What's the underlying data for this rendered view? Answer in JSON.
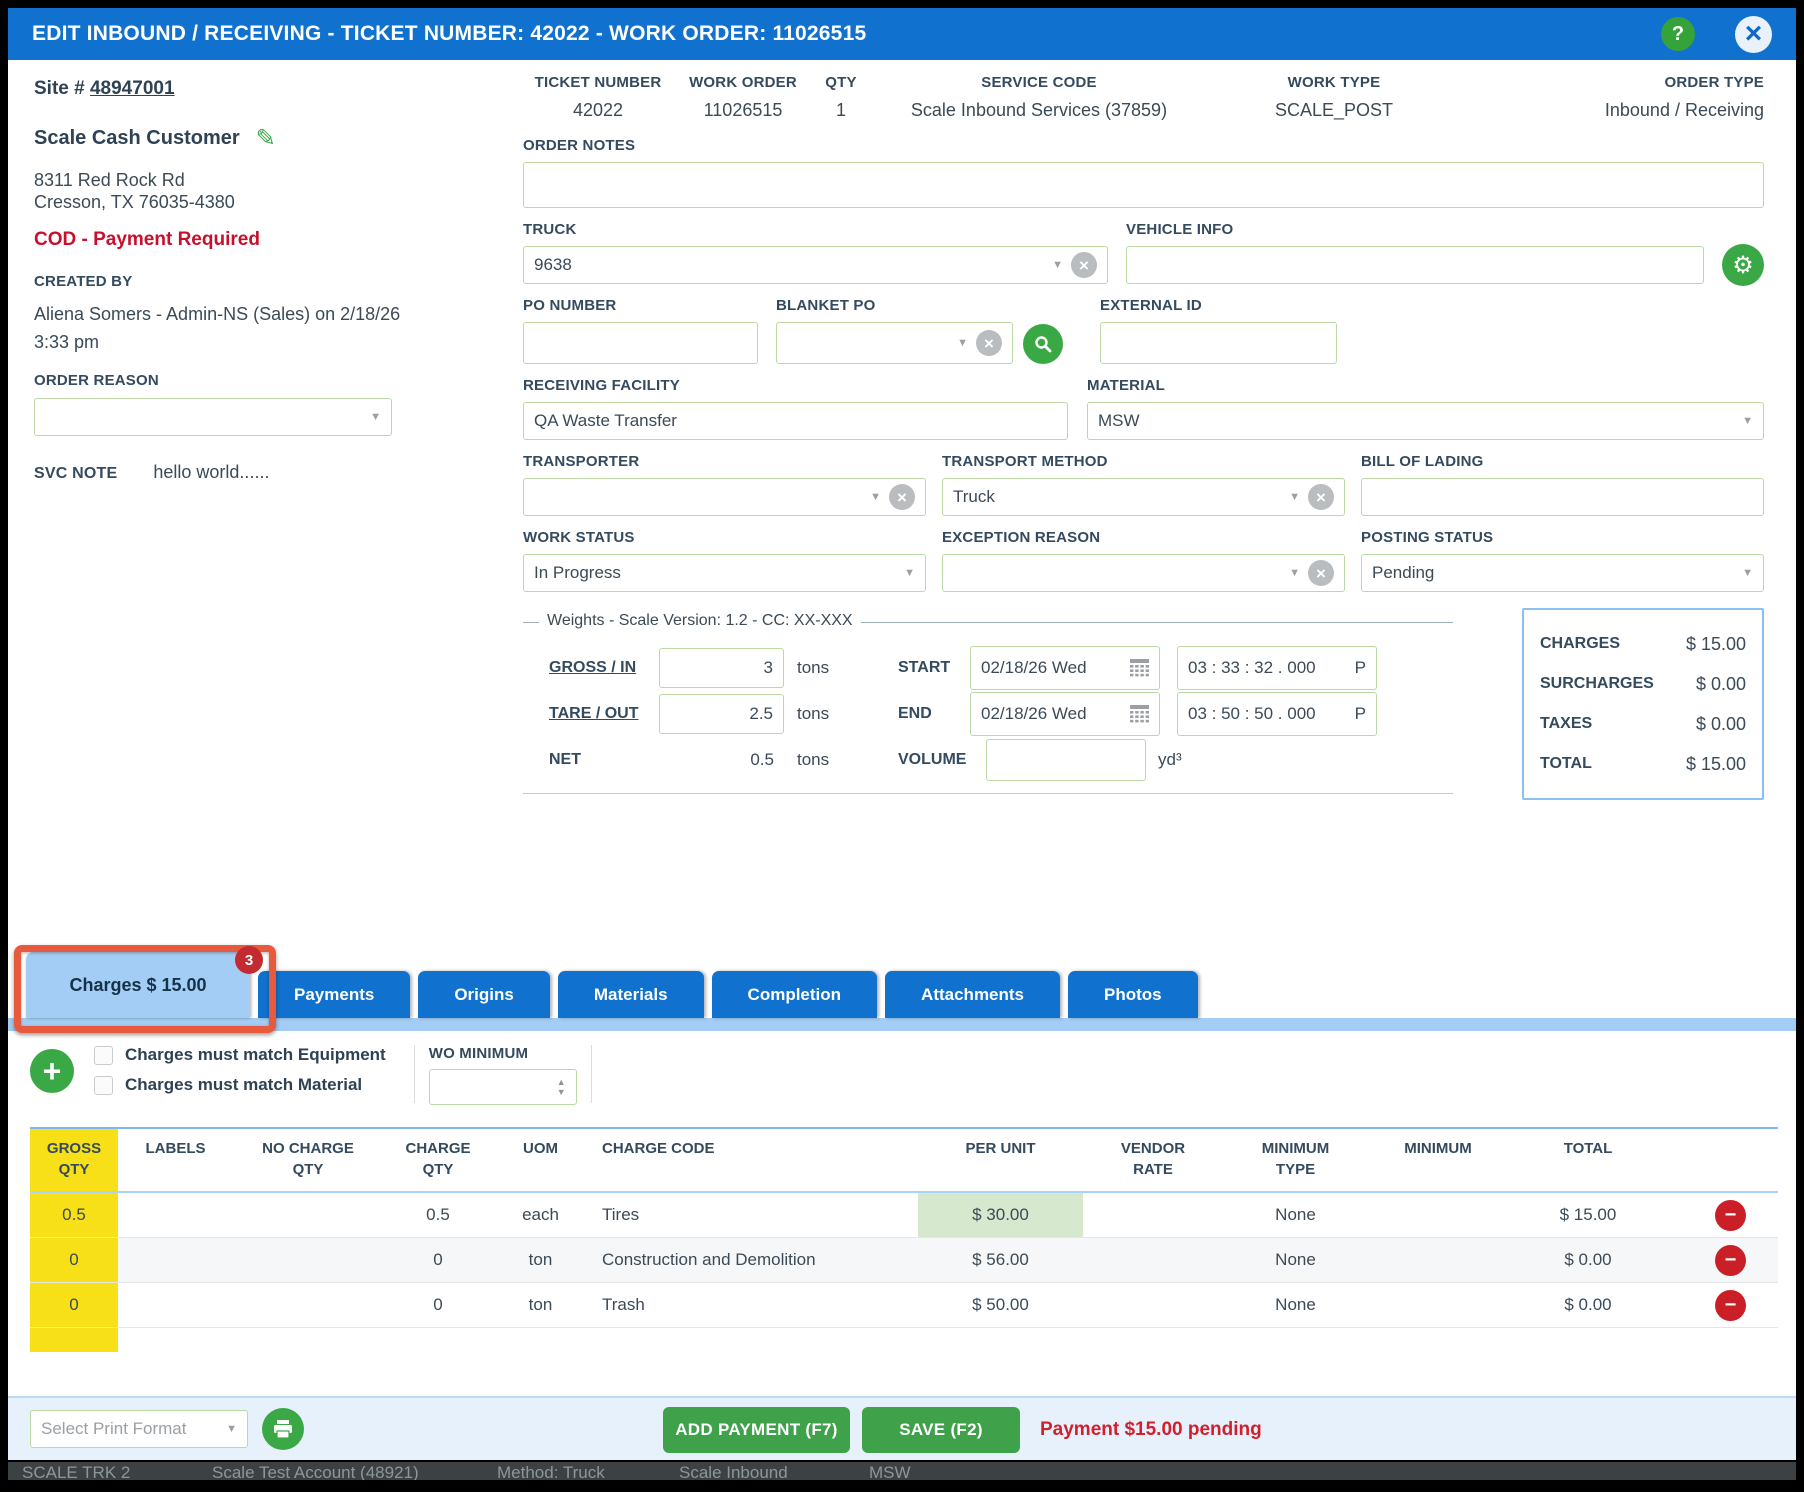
{
  "colors": {
    "titlebar_blue": "#1171ce",
    "active_tab_blue": "#a3cdf4",
    "annotation_orange": "#e85a3e",
    "highlight_yellow": "#f7e017",
    "per_unit_highlight_green": "#d6e9cf",
    "cod_red": "#c8102e",
    "button_green": "#3fa24b",
    "icon_green": "#3aa945",
    "input_border_green": "#bcd9a5",
    "badge_red": "#c22b30",
    "delete_red": "#cb1f27"
  },
  "icons": {
    "help": "?",
    "close": "×",
    "edit_pencil": "✎",
    "gear": "⚙",
    "dropdown_arrow": "▼",
    "clear": "×",
    "add": "+",
    "spinner_up": "▲",
    "spinner_down": "▼",
    "delete_minus": "−"
  },
  "titlebar": {
    "title": "EDIT INBOUND / RECEIVING - TICKET NUMBER: 42022 - WORK ORDER: 11026515"
  },
  "sidebar": {
    "site_label": "Site #",
    "site_number": "48947001",
    "customer_name": "Scale Cash Customer",
    "address_line1": "8311 Red Rock Rd",
    "address_line2": "Cresson, TX 76035-4380",
    "cod_warning": "COD - Payment Required",
    "created_by_label": "CREATED BY",
    "created_by_text": "Aliena Somers - Admin-NS (Sales) on 2/18/26 3:33 pm",
    "order_reason_label": "ORDER REASON",
    "order_reason_value": "",
    "svc_note_label": "SVC NOTE",
    "svc_note_text": "hello world......"
  },
  "order_info": {
    "fields": [
      {
        "label": "TICKET NUMBER",
        "value": "42022"
      },
      {
        "label": "WORK ORDER",
        "value": "11026515"
      },
      {
        "label": "QTY",
        "value": "1"
      },
      {
        "label": "SERVICE CODE",
        "value": "Scale Inbound Services (37859)"
      },
      {
        "label": "WORK TYPE",
        "value": "SCALE_POST"
      },
      {
        "label": "ORDER TYPE",
        "value": "Inbound / Receiving"
      }
    ]
  },
  "form": {
    "order_notes_label": "ORDER NOTES",
    "order_notes_value": "",
    "truck_label": "TRUCK",
    "truck_value": "9638",
    "vehicle_info_label": "VEHICLE INFO",
    "vehicle_info_value": "",
    "po_number_label": "PO NUMBER",
    "po_number_value": "",
    "blanket_po_label": "BLANKET PO",
    "blanket_po_value": "",
    "external_id_label": "EXTERNAL ID",
    "external_id_value": "",
    "receiving_facility_label": "RECEIVING FACILITY",
    "receiving_facility_value": "QA Waste Transfer",
    "material_label": "MATERIAL",
    "material_value": "MSW",
    "transporter_label": "TRANSPORTER",
    "transporter_value": "",
    "transport_method_label": "TRANSPORT METHOD",
    "transport_method_value": "Truck",
    "bill_of_lading_label": "BILL OF LADING",
    "bill_of_lading_value": "",
    "work_status_label": "WORK STATUS",
    "work_status_value": "In Progress",
    "exception_reason_label": "EXCEPTION REASON",
    "exception_reason_value": "",
    "posting_status_label": "POSTING STATUS",
    "posting_status_value": "Pending"
  },
  "weights": {
    "legend": "Weights - Scale Version: 1.2 - CC: XX-XXX",
    "gross_label": "GROSS / IN",
    "gross_value": "3",
    "tare_label": "TARE / OUT",
    "tare_value": "2.5",
    "net_label": "NET",
    "net_value": "0.5",
    "unit": "tons",
    "start_label": "START",
    "start_date": "02/18/26 Wed",
    "start_time": "03 : 33 : 32 . 000",
    "end_label": "END",
    "end_date": "02/18/26 Wed",
    "end_time": "03 : 50 : 50 . 000",
    "meridiem": "P",
    "volume_label": "VOLUME",
    "volume_value": "",
    "volume_unit": "yd³"
  },
  "totals": {
    "rows": [
      {
        "label": "CHARGES",
        "value": "$ 15.00"
      },
      {
        "label": "SURCHARGES",
        "value": "$ 0.00"
      },
      {
        "label": "TAXES",
        "value": "$ 0.00"
      },
      {
        "label": "TOTAL",
        "value": "$ 15.00"
      }
    ]
  },
  "tabs": {
    "active_label": "Charges $ 15.00",
    "active_badge": "3",
    "items": [
      {
        "label": "Payments"
      },
      {
        "label": "Origins"
      },
      {
        "label": "Materials"
      },
      {
        "label": "Completion"
      },
      {
        "label": "Attachments"
      },
      {
        "label": "Photos"
      }
    ]
  },
  "charges": {
    "match_equipment_label": "Charges must match Equipment",
    "match_material_label": "Charges must match Material",
    "wo_minimum_label": "WO MINIMUM",
    "wo_minimum_value": "",
    "table": {
      "headers": [
        "GROSS\nQTY",
        "LABELS",
        "NO CHARGE\nQTY",
        "CHARGE\nQTY",
        "UOM",
        "CHARGE CODE",
        "PER UNIT",
        "VENDOR\nRATE",
        "MINIMUM\nTYPE",
        "MINIMUM",
        "TOTAL"
      ],
      "rows": [
        {
          "cells": [
            "0.5",
            "",
            "",
            "0.5",
            "each",
            "Tires",
            "$ 30.00",
            "",
            "None",
            "",
            "$ 15.00"
          ]
        },
        {
          "cells": [
            "0",
            "",
            "",
            "0",
            "ton",
            "Construction and Demolition",
            "$ 56.00",
            "",
            "None",
            "",
            "$ 0.00"
          ]
        },
        {
          "cells": [
            "0",
            "",
            "",
            "0",
            "ton",
            "Trash",
            "$ 50.00",
            "",
            "None",
            "",
            "$ 0.00"
          ]
        }
      ]
    }
  },
  "footer": {
    "print_format_placeholder": "Select Print Format",
    "add_payment_label": "ADD PAYMENT (F7)",
    "save_label": "SAVE (F2)",
    "payment_status": "Payment $15.00 pending"
  },
  "background_row": {
    "items": [
      "SCALE TRK 2",
      "Scale Test Account (48921)",
      "Method: Truck",
      "Scale Inbound",
      "MSW"
    ]
  }
}
